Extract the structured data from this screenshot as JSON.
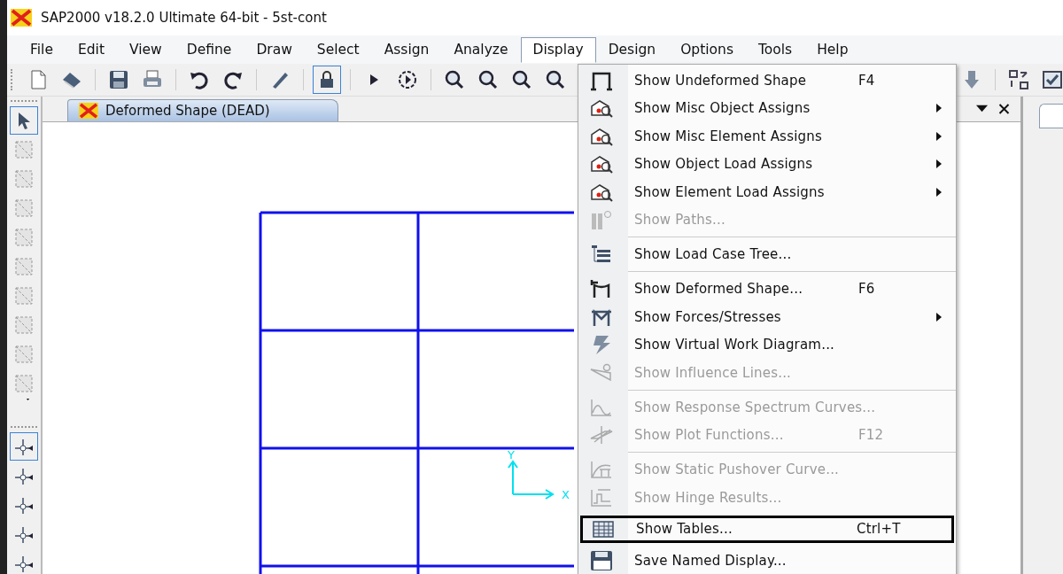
{
  "window": {
    "title": "SAP2000 v18.2.0 Ultimate 64-bit - 5st-cont"
  },
  "menu_bar": [
    {
      "label": "File",
      "selected": false
    },
    {
      "label": "Edit",
      "selected": false
    },
    {
      "label": "View",
      "selected": false
    },
    {
      "label": "Define",
      "selected": false
    },
    {
      "label": "Draw",
      "selected": false
    },
    {
      "label": "Select",
      "selected": false
    },
    {
      "label": "Assign",
      "selected": false
    },
    {
      "label": "Analyze",
      "selected": false
    },
    {
      "label": "Display",
      "selected": true
    },
    {
      "label": "Design",
      "selected": false
    },
    {
      "label": "Options",
      "selected": false
    },
    {
      "label": "Tools",
      "selected": false
    },
    {
      "label": "Help",
      "selected": false
    }
  ],
  "document_tab": {
    "label": "Deformed Shape (DEAD)",
    "selected": true
  },
  "view_axes": {
    "y": "Y",
    "x": "X"
  },
  "display_menu": [
    {
      "kind": "item",
      "label": "Show Undeformed Shape",
      "shortcut": "F4",
      "submenu": false,
      "disabled": false,
      "highlighted": false
    },
    {
      "kind": "item",
      "label": "Show Misc Object Assigns",
      "submenu": true,
      "disabled": false,
      "highlighted": false
    },
    {
      "kind": "item",
      "label": "Show Misc Element Assigns",
      "submenu": true,
      "disabled": false,
      "highlighted": false
    },
    {
      "kind": "item",
      "label": "Show Object Load Assigns",
      "submenu": true,
      "disabled": false,
      "highlighted": false
    },
    {
      "kind": "item",
      "label": "Show Element Load Assigns",
      "submenu": true,
      "disabled": false,
      "highlighted": false
    },
    {
      "kind": "item",
      "label": "Show Paths...",
      "submenu": false,
      "disabled": true,
      "highlighted": false
    },
    {
      "kind": "separator"
    },
    {
      "kind": "item",
      "label": "Show Load Case Tree...",
      "submenu": false,
      "disabled": false,
      "highlighted": false
    },
    {
      "kind": "separator"
    },
    {
      "kind": "item",
      "label": "Show Deformed Shape...",
      "shortcut": "F6",
      "submenu": false,
      "disabled": false,
      "highlighted": false
    },
    {
      "kind": "item",
      "label": "Show Forces/Stresses",
      "submenu": true,
      "disabled": false,
      "highlighted": false
    },
    {
      "kind": "item",
      "label": "Show Virtual Work Diagram...",
      "submenu": false,
      "disabled": false,
      "highlighted": false
    },
    {
      "kind": "item",
      "label": "Show Influence Lines...",
      "submenu": false,
      "disabled": true,
      "highlighted": false
    },
    {
      "kind": "separator"
    },
    {
      "kind": "item",
      "label": "Show Response Spectrum Curves...",
      "submenu": false,
      "disabled": true,
      "highlighted": false
    },
    {
      "kind": "item",
      "label": "Show Plot Functions...",
      "shortcut": "F12",
      "submenu": false,
      "disabled": true,
      "highlighted": false
    },
    {
      "kind": "separator"
    },
    {
      "kind": "item",
      "label": "Show Static Pushover Curve...",
      "submenu": false,
      "disabled": true,
      "highlighted": false
    },
    {
      "kind": "item",
      "label": "Show Hinge Results...",
      "submenu": false,
      "disabled": true,
      "highlighted": false
    },
    {
      "kind": "item",
      "label": "Show Tables...",
      "shortcut": "Ctrl+T",
      "submenu": false,
      "disabled": false,
      "highlighted": true
    },
    {
      "kind": "item",
      "label": "Save Named Display...",
      "submenu": false,
      "disabled": false,
      "highlighted": false
    }
  ]
}
